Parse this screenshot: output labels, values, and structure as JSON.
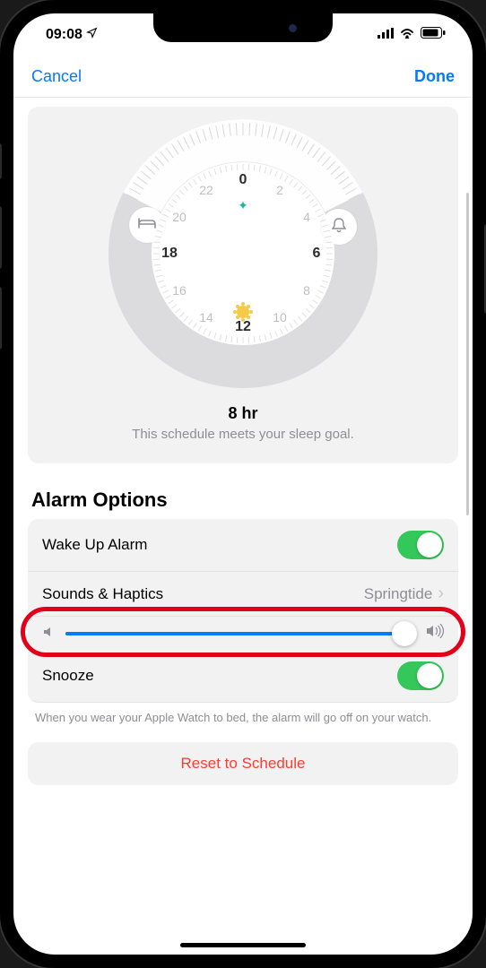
{
  "status": {
    "time": "09:08"
  },
  "nav": {
    "cancel": "Cancel",
    "done": "Done"
  },
  "clock": {
    "labels": [
      "0",
      "2",
      "4",
      "6",
      "8",
      "10",
      "12",
      "14",
      "16",
      "18",
      "20",
      "22"
    ],
    "bold_labels": [
      "0",
      "6",
      "12",
      "18"
    ],
    "duration_title": "8 hr",
    "duration_sub": "This schedule meets your sleep goal."
  },
  "alarm": {
    "section_title": "Alarm Options",
    "wake_label": "Wake Up Alarm",
    "wake_on": true,
    "sounds_label": "Sounds & Haptics",
    "sounds_value": "Springtide",
    "volume_pct": 94,
    "snooze_label": "Snooze",
    "snooze_on": true,
    "footer_note": "When you wear your Apple Watch to bed, the alarm will go off on your watch."
  },
  "reset": {
    "label": "Reset to Schedule"
  },
  "colors": {
    "accent": "#007aff",
    "green": "#34c759",
    "destructive": "#ff3b30"
  }
}
